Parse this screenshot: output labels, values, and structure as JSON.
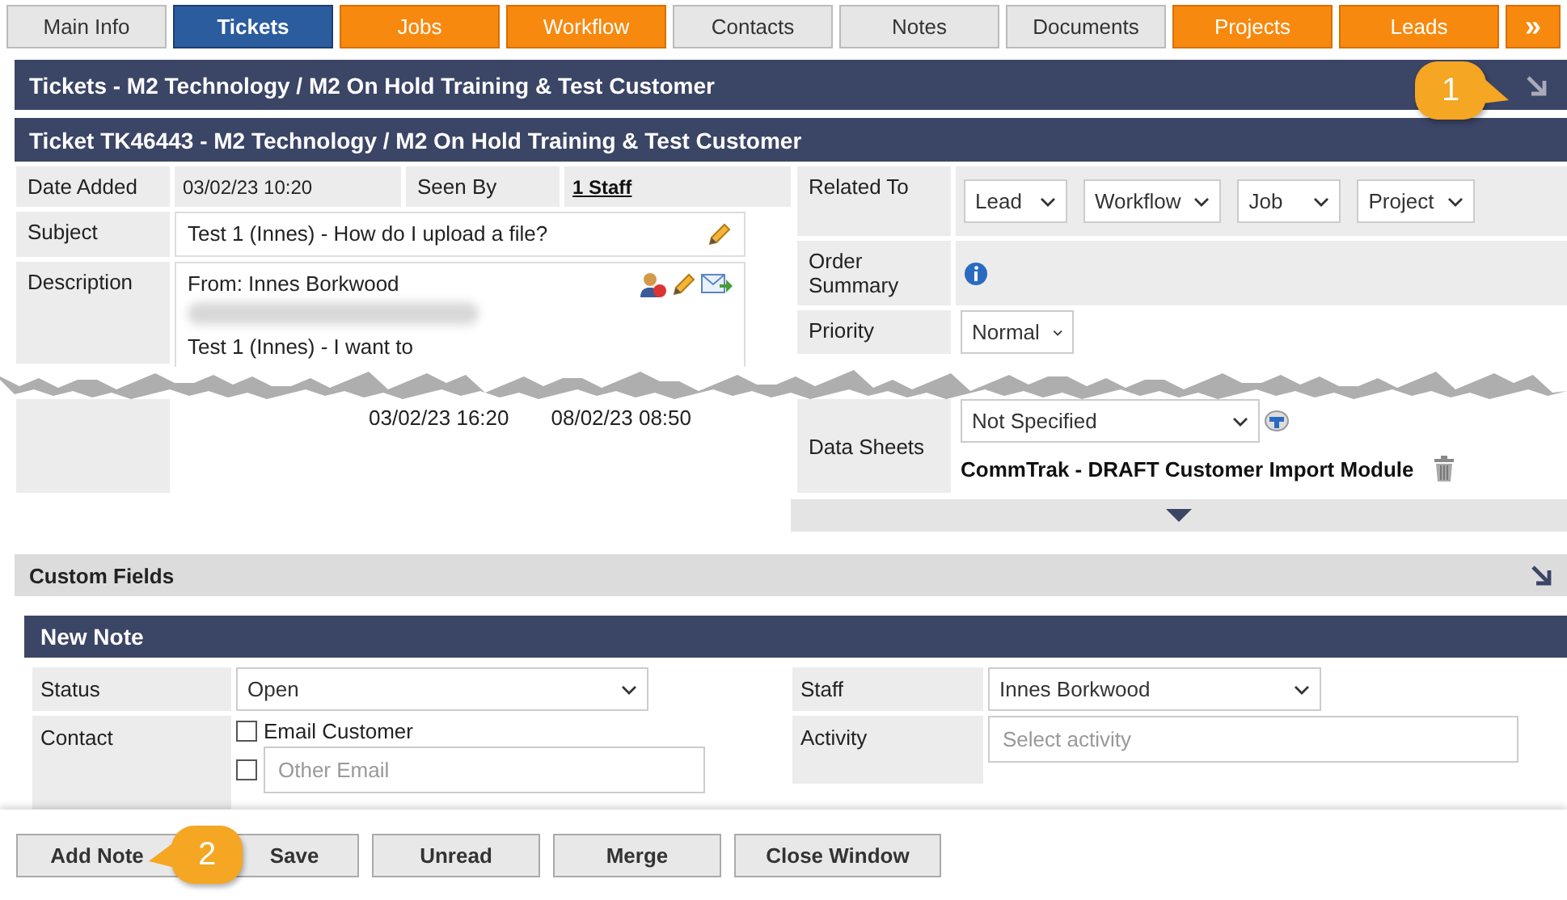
{
  "nav_tabs": [
    {
      "label": "Main Info",
      "color": "#e6e6e6",
      "selected": false
    },
    {
      "label": "Tickets",
      "color": "#2b5c9e",
      "selected": true
    },
    {
      "label": "Jobs",
      "color": "#f7890f",
      "selected": false
    },
    {
      "label": "Workflow",
      "color": "#f7890f",
      "selected": false
    },
    {
      "label": "Contacts",
      "color": "#e6e6e6",
      "selected": false
    },
    {
      "label": "Notes",
      "color": "#e6e6e6",
      "selected": false
    },
    {
      "label": "Documents",
      "color": "#e6e6e6",
      "selected": false
    },
    {
      "label": "Projects",
      "color": "#f7890f",
      "selected": false
    },
    {
      "label": "Leads",
      "color": "#f7890f",
      "selected": false
    }
  ],
  "more_button": "»",
  "tickets_panel": {
    "title": "Tickets - M2 Technology / M2 On Hold Training & Test Customer",
    "callout": "1"
  },
  "ticket": {
    "title": "Ticket TK46443 - M2 Technology / M2 On Hold Training & Test Customer",
    "date_added": {
      "label": "Date Added",
      "value": "03/02/23 10:20"
    },
    "seen_by": {
      "label": "Seen By",
      "value": "1 Staff"
    },
    "subject": {
      "label": "Subject",
      "value": "Test 1 (Innes) - How do I upload a file?"
    },
    "description": {
      "label": "Description",
      "from": "From: Innes Borkwood",
      "body": "Test 1 (Innes) - I want to"
    },
    "responses": "03/02/23 16:20",
    "closure": "08/02/23 08:50",
    "related_to": {
      "label": "Related To",
      "selects": [
        "Lead",
        "Workflow",
        "Job",
        "Project"
      ]
    },
    "order_summary": {
      "label": "Order Summary"
    },
    "priority": {
      "label": "Priority",
      "value": "Normal"
    },
    "data_sheets": {
      "label": "Data Sheets",
      "value": "Not Specified",
      "item": "CommTrak - DRAFT Customer Import Module"
    }
  },
  "custom_fields": {
    "title": "Custom Fields"
  },
  "new_note": {
    "title": "New Note",
    "status": {
      "label": "Status",
      "value": "Open"
    },
    "contact": {
      "label": "Contact",
      "email_customer": {
        "label": "Email Customer",
        "checked": false
      },
      "other_email": {
        "placeholder": "Other Email",
        "checked": false
      }
    },
    "staff": {
      "label": "Staff",
      "value": "Innes Borkwood"
    },
    "activity": {
      "label": "Activity",
      "placeholder": "Select activity"
    }
  },
  "buttons": [
    "Add Note",
    "Save",
    "Unread",
    "Merge",
    "Close Window"
  ],
  "footer_callout": "2"
}
